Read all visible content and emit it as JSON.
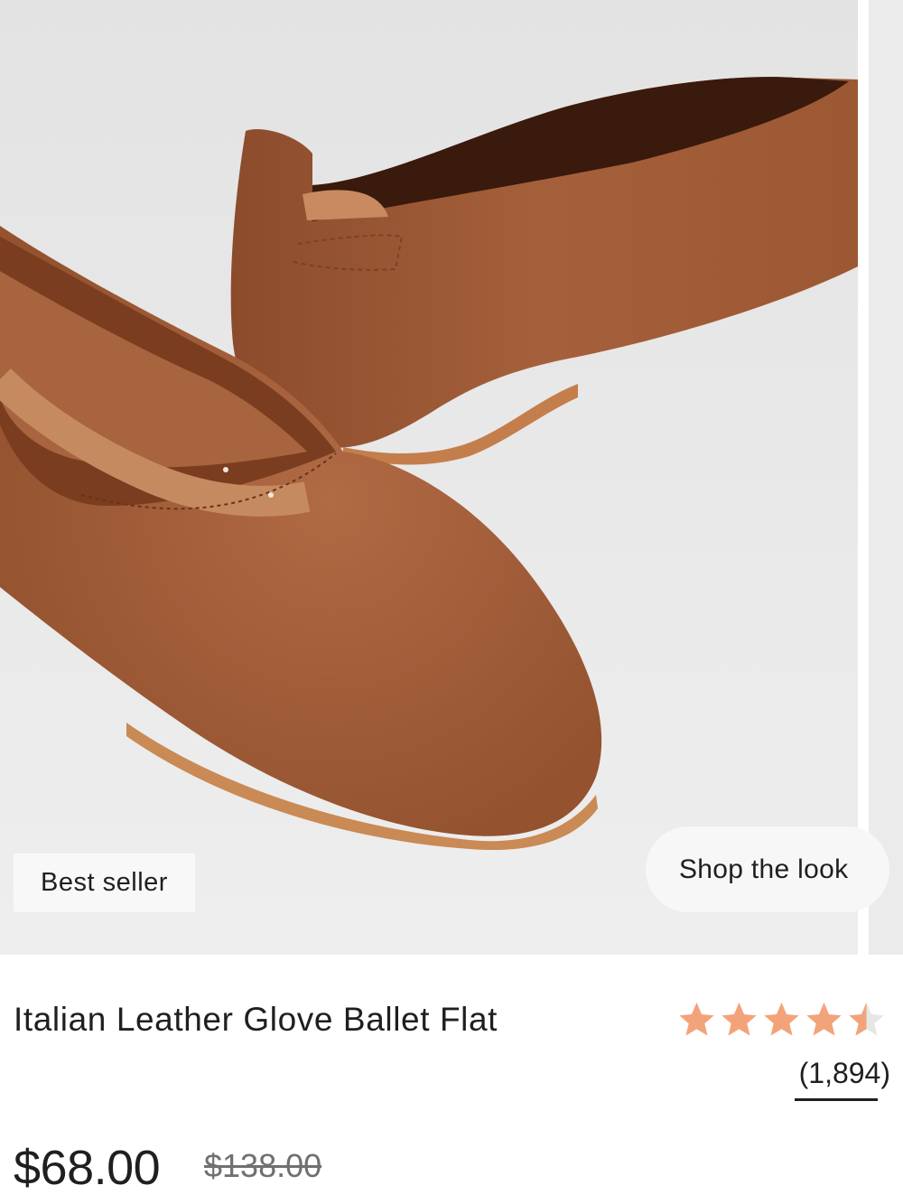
{
  "product": {
    "badge": "Best seller",
    "shop_the_look_label": "Shop the look",
    "title": "Italian Leather Glove Ballet Flat",
    "rating": 4.5,
    "rating_max": 5,
    "review_count": "(1,894)",
    "price": "$68.00",
    "compare_price": "$138.00"
  },
  "colors": {
    "leather": "#a5603b",
    "star": "#f3a37a",
    "background": "#ebebeb"
  },
  "icons": {
    "star": "star-icon",
    "half_star": "star-half-icon"
  }
}
